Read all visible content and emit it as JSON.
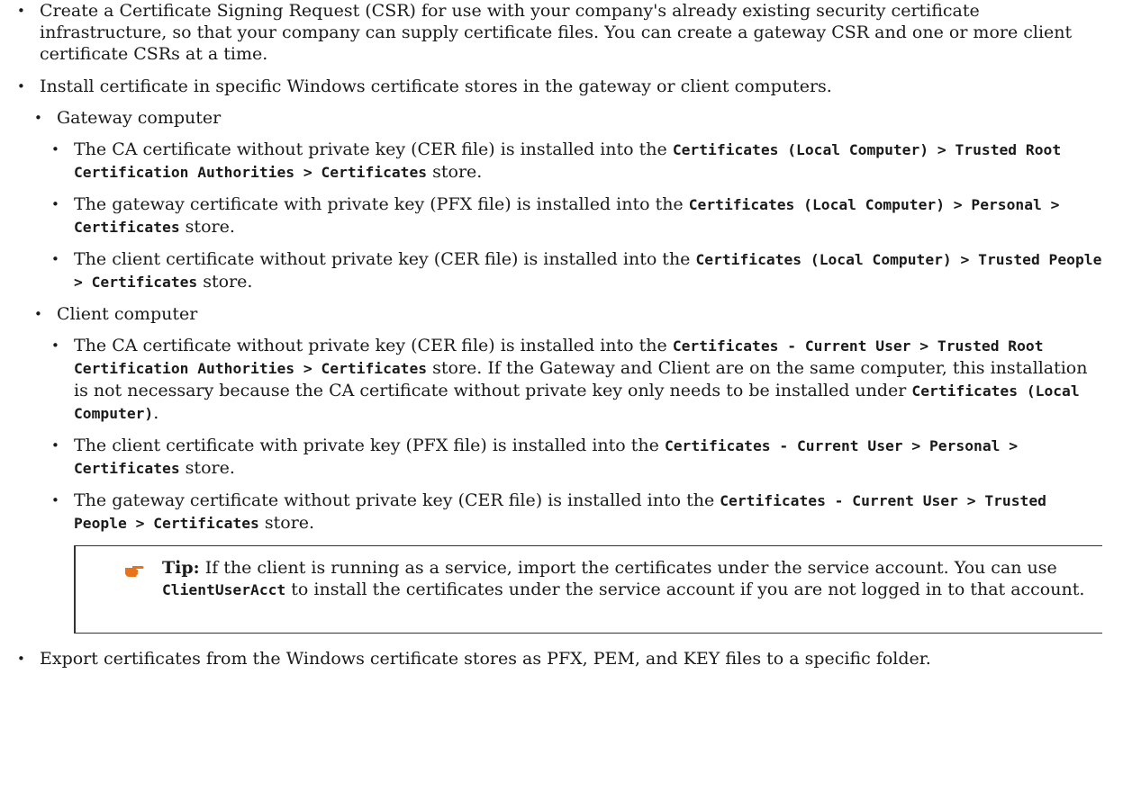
{
  "bullet_char": "•",
  "items": [
    {
      "text": "Create a Certificate Signing Request (CSR) for use with your company's already existing security certificate infrastructure, so that your company can supply certificate files. You can create a gateway CSR and one or more client certificate CSRs at a time."
    },
    {
      "text": "Install certificate in specific Windows certificate stores in the gateway or client computers.",
      "groups": [
        {
          "label": "Gateway computer",
          "entries": [
            {
              "prefix": "The CA certificate without private key (CER file) is installed into the ",
              "code": "Certificates (Local Computer) > Trusted Root Certification Authorities > Certificates",
              "suffix": " store."
            },
            {
              "prefix": "The gateway certificate with private key (PFX file) is installed into the ",
              "code": "Certificates (Local Computer) > Personal > Certificates",
              "suffix": " store."
            },
            {
              "prefix": "The client certificate without private key (CER file) is installed into the ",
              "code": "Certificates (Local Computer) > Trusted People > Certificates",
              "suffix": " store."
            }
          ]
        },
        {
          "label": "Client computer",
          "entries": [
            {
              "prefix": "The CA certificate without private key (CER file) is installed into the ",
              "code": "Certificates - Current User > Trusted Root Certification Authorities > Certificates",
              "suffix": " store. If the Gateway and Client are on the same computer, this installation is not necessary because the CA certificate without private key only needs to be installed under ",
              "code2": "Certificates (Local Computer)",
              "suffix2": "."
            },
            {
              "prefix": "The client certificate with private key (PFX file) is installed into the ",
              "code": "Certificates - Current User > Personal > Certificates",
              "suffix": " store."
            },
            {
              "prefix": "The gateway certificate without private key (CER file) is installed into the ",
              "code": "Certificates - Current User > Trusted People > Certificates",
              "suffix": " store."
            }
          ]
        }
      ],
      "tip": {
        "icon": "pointing-hand-icon",
        "icon_color": "#e8731a",
        "label": "Tip:",
        "text1": " If the client is running as a service, import the certificates under the service account. You can use ",
        "code": "ClientUserAcct",
        "text2": " to install the certificates under the service account if you are not logged in to that account."
      }
    },
    {
      "text": "Export certificates from the Windows certificate stores as PFX, PEM, and KEY files to a specific folder."
    }
  ]
}
